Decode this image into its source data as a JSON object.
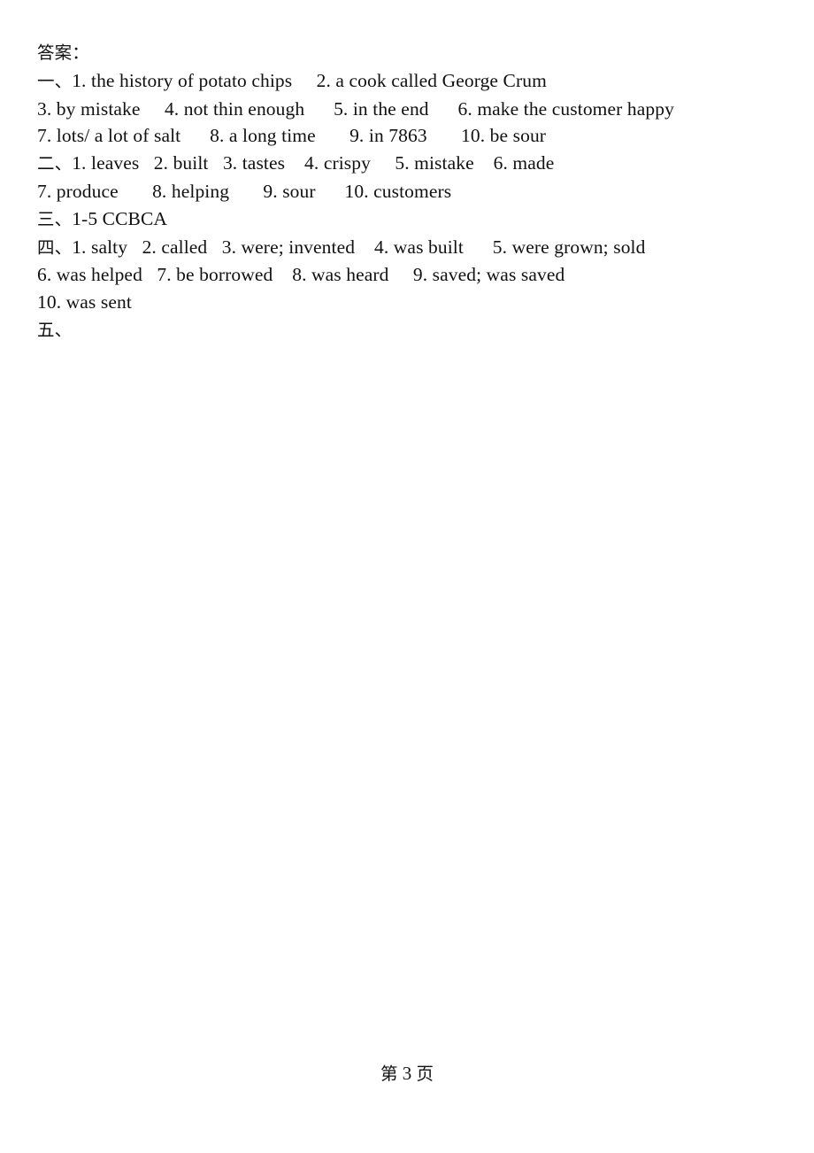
{
  "document": {
    "title_label": "答案：",
    "page_footer": {
      "prefix": "第",
      "page_number": "3",
      "suffix": "页",
      "full": "第 3 页"
    },
    "sections": [
      {
        "marker": "一、",
        "lines": [
          "一、 1. the history of potato chips     2. a cook called George Crum",
          "3. by mistake     4. not thin enough      5. in the end      6. make the customer happy",
          "7. lots/ a lot of salt      8. a long time       9. in 7863       10. be sour"
        ],
        "items": [
          "1. the history of potato chips",
          "2. a cook called George Crum",
          "3. by mistake",
          "4. not thin enough",
          "5. in the end",
          "6. make the customer happy",
          "7. lots/ a lot of salt",
          "8. a long time",
          "9. in 7863",
          "10. be sour"
        ]
      },
      {
        "marker": "二、",
        "lines": [
          "二、 1. leaves   2. built   3. tastes    4. crispy     5. mistake    6. made",
          "7. produce       8. helping       9. sour      10. customers"
        ],
        "items": [
          "1. leaves",
          "2. built",
          "3. tastes",
          "4. crispy",
          "5. mistake",
          "6. made",
          "7. produce",
          "8. helping",
          "9. sour",
          "10. customers"
        ]
      },
      {
        "marker": "三、",
        "lines": [
          "三、 1-5 CCBCA"
        ],
        "items": [
          "1-5 CCBCA"
        ]
      },
      {
        "marker": "四、",
        "lines": [
          "四、 1. salty   2. called   3. were; invented    4. was built      5. were grown; sold",
          "6. was helped   7. be borrowed    8. was heard     9. saved; was saved",
          "10. was sent"
        ],
        "items": [
          "1. salty",
          "2. called",
          "3. were; invented",
          "4. was built",
          "5. were grown; sold",
          "6. was helped",
          "7. be borrowed",
          "8. was heard",
          "9. saved; was saved",
          "10. was sent"
        ]
      },
      {
        "marker": "五、",
        "lines": [
          "五、"
        ],
        "items": []
      }
    ],
    "body_lines": [
      "答案：",
      "一、 1. the history of potato chips     2. a cook called George Crum",
      "3. by mistake     4. not thin enough      5. in the end      6. make the customer happy",
      "7. lots/ a lot of salt      8. a long time       9. in 7863       10. be sour",
      "二、 1. leaves   2. built   3. tastes    4. crispy     5. mistake    6. made",
      "7. produce       8. helping       9. sour      10. customers",
      "三、 1-5 CCBCA",
      "四、 1. salty   2. called   3. were; invented    4. was built      5. were grown; sold",
      "6. was helped   7. be borrowed    8. was heard     9. saved; was saved",
      "10. was sent",
      "五、"
    ]
  },
  "colors": {
    "page_background": "#ffffff",
    "text": "#111111"
  }
}
